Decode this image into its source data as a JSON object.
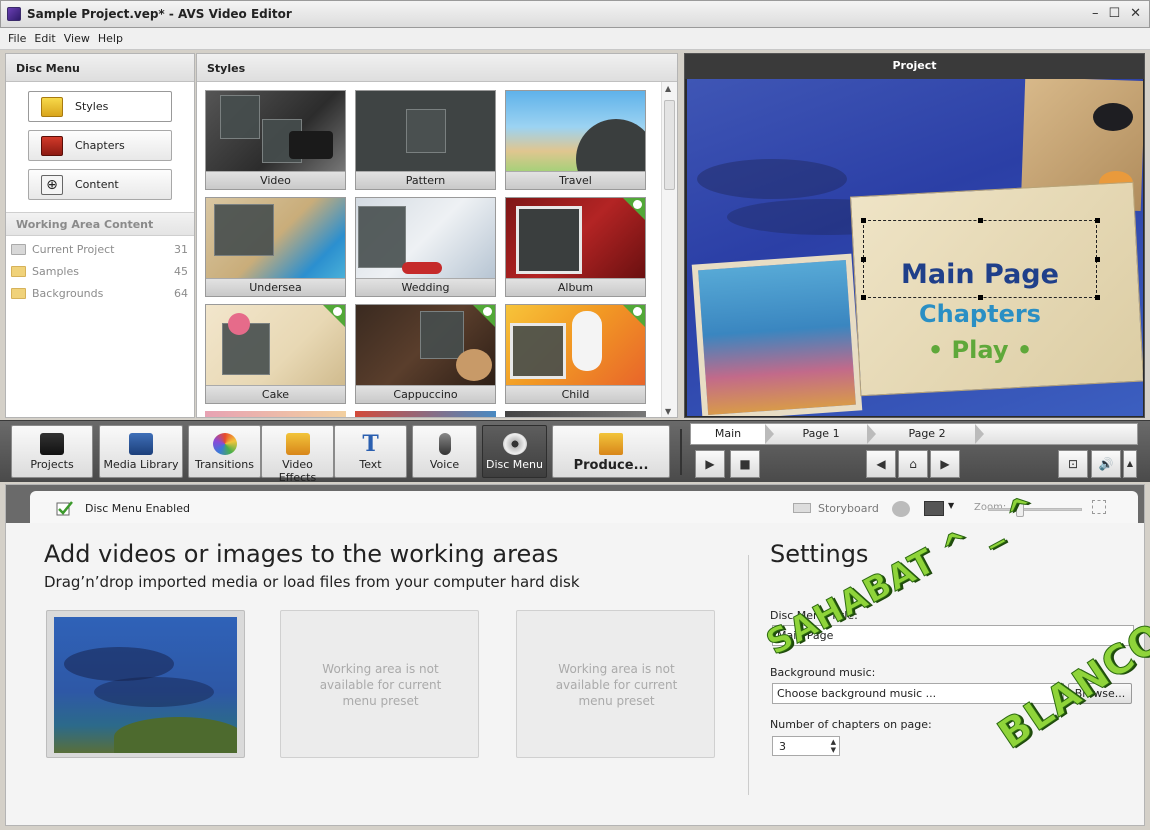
{
  "window": {
    "title": "Sample Project.vep* - AVS Video Editor",
    "controls": [
      "–",
      "☐",
      "✕"
    ]
  },
  "menu": [
    "File",
    "Edit",
    "View",
    "Help"
  ],
  "disc_menu_panel": {
    "header": "Disc Menu",
    "buttons": [
      {
        "label": "Styles",
        "icon": "styles-icon"
      },
      {
        "label": "Chapters",
        "icon": "chapters-icon"
      },
      {
        "label": "Content",
        "icon": "content-icon"
      }
    ],
    "working_area_header": "Working Area Content",
    "items": [
      {
        "label": "Current Project",
        "count": "31",
        "icon": "gear-folder-icon"
      },
      {
        "label": "Samples",
        "count": "45",
        "icon": "folder-icon"
      },
      {
        "label": "Backgrounds",
        "count": "64",
        "icon": "folder-icon"
      }
    ]
  },
  "styles_panel": {
    "header": "Styles",
    "tiles": [
      {
        "label": "Video"
      },
      {
        "label": "Pattern"
      },
      {
        "label": "Travel"
      },
      {
        "label": "Undersea"
      },
      {
        "label": "Wedding"
      },
      {
        "label": "Album"
      },
      {
        "label": "Cake"
      },
      {
        "label": "Cappuccino"
      },
      {
        "label": "Child"
      }
    ]
  },
  "preview": {
    "header": "Project",
    "menu_texts": {
      "main": "Main Page",
      "chapters": "Chapters",
      "play": "• Play •"
    }
  },
  "toolbar": {
    "buttons": [
      {
        "label": "Projects"
      },
      {
        "label": "Media Library"
      },
      {
        "label": "Transitions"
      },
      {
        "label": "Video Effects"
      },
      {
        "label": "Text"
      },
      {
        "label": "Voice"
      },
      {
        "label": "Disc Menu"
      },
      {
        "label": "Produce..."
      }
    ],
    "timeline_tabs": [
      "Main",
      "Page 1",
      "Page 2"
    ],
    "controls": {
      "play": "▶",
      "stop": "■",
      "prev": "◀",
      "home": "⌂",
      "next": "▶",
      "fit": "⊡",
      "volume": "🔊",
      "more": "▲"
    }
  },
  "bottom": {
    "enabled_label": "Disc Menu Enabled",
    "storyboard_label": "Storyboard",
    "zoom_label": "Zoom:",
    "heading": "Add videos or images to the working areas",
    "subheading": "Drag’n’drop imported media or load files from your computer hard disk",
    "working_area_note": "Working area is not available for current menu preset",
    "settings": {
      "heading": "Settings",
      "title_label": "Disc Menu Title:",
      "title_value": "Main Page",
      "background_label": "Background music:",
      "background_value": "Choose background music ...",
      "browse_label": "Browse...",
      "chapters_label": "Number of chapters on page:",
      "chapters_value": "3"
    }
  },
  "watermark": {
    "line1": "SAHABAT ^ _ ^",
    "line2": "BLANCO"
  },
  "colors": {
    "toolbar_bg": "#4a4a4a",
    "badge_green": "#52a838",
    "preview_title": "#1f3f8a",
    "preview_chapters": "#2a8fc4",
    "preview_play": "#5fa83a"
  }
}
